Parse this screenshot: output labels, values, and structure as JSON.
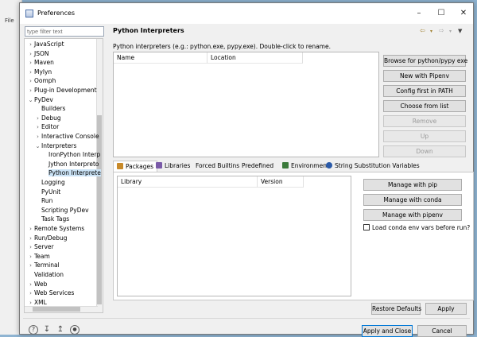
{
  "window": {
    "title": "Preferences"
  },
  "background": {
    "menu_file": "File"
  },
  "filter": {
    "placeholder": "type filter text"
  },
  "tree": [
    {
      "label": "JavaScript",
      "depth": 0,
      "arrow": "›"
    },
    {
      "label": "JSON",
      "depth": 0,
      "arrow": "›"
    },
    {
      "label": "Maven",
      "depth": 0,
      "arrow": "›"
    },
    {
      "label": "Mylyn",
      "depth": 0,
      "arrow": "›"
    },
    {
      "label": "Oomph",
      "depth": 0,
      "arrow": "›"
    },
    {
      "label": "Plug-in Development",
      "depth": 0,
      "arrow": "›"
    },
    {
      "label": "PyDev",
      "depth": 0,
      "arrow": "⌄"
    },
    {
      "label": "Builders",
      "depth": 1,
      "arrow": ""
    },
    {
      "label": "Debug",
      "depth": 1,
      "arrow": "›"
    },
    {
      "label": "Editor",
      "depth": 1,
      "arrow": "›"
    },
    {
      "label": "Interactive Console",
      "depth": 1,
      "arrow": "›"
    },
    {
      "label": "Interpreters",
      "depth": 1,
      "arrow": "⌄"
    },
    {
      "label": "IronPython Interp",
      "depth": 2,
      "arrow": ""
    },
    {
      "label": "Jython Interpreto",
      "depth": 2,
      "arrow": ""
    },
    {
      "label": "Python Interprete",
      "depth": 2,
      "arrow": "",
      "selected": true
    },
    {
      "label": "Logging",
      "depth": 1,
      "arrow": ""
    },
    {
      "label": "PyUnit",
      "depth": 1,
      "arrow": ""
    },
    {
      "label": "Run",
      "depth": 1,
      "arrow": ""
    },
    {
      "label": "Scripting PyDev",
      "depth": 1,
      "arrow": ""
    },
    {
      "label": "Task Tags",
      "depth": 1,
      "arrow": ""
    },
    {
      "label": "Remote Systems",
      "depth": 0,
      "arrow": "›"
    },
    {
      "label": "Run/Debug",
      "depth": 0,
      "arrow": "›"
    },
    {
      "label": "Server",
      "depth": 0,
      "arrow": "›"
    },
    {
      "label": "Team",
      "depth": 0,
      "arrow": "›"
    },
    {
      "label": "Terminal",
      "depth": 0,
      "arrow": "›"
    },
    {
      "label": "Validation",
      "depth": 0,
      "arrow": ""
    },
    {
      "label": "Web",
      "depth": 0,
      "arrow": "›"
    },
    {
      "label": "Web Services",
      "depth": 0,
      "arrow": "›"
    },
    {
      "label": "XML",
      "depth": 0,
      "arrow": "›"
    }
  ],
  "page": {
    "title": "Python Interpreters",
    "description": "Python interpreters (e.g.: python.exe, pypy.exe).   Double-click to rename."
  },
  "interpreters_table": {
    "col_name": "Name",
    "col_location": "Location"
  },
  "interp_buttons": [
    {
      "label": "Browse for python/pypy exe",
      "enabled": true
    },
    {
      "label": "New with Pipenv",
      "enabled": true
    },
    {
      "label": "Config first in PATH",
      "enabled": true
    },
    {
      "label": "Choose from list",
      "enabled": true
    },
    {
      "label": "Remove",
      "enabled": false
    },
    {
      "label": "Up",
      "enabled": false
    },
    {
      "label": "Down",
      "enabled": false
    }
  ],
  "tabs": [
    "Packages",
    "Libraries",
    "Forced Builtins",
    "Predefined",
    "Environment",
    "String Substitution Variables"
  ],
  "packages_table": {
    "col_library": "Library",
    "col_version": "Version"
  },
  "pkg_buttons": [
    "Manage with pip",
    "Manage with conda",
    "Manage with pipenv"
  ],
  "conda_checkbox": {
    "label": "Load conda env vars before run?",
    "checked": false
  },
  "footer": {
    "restore_defaults": "Restore Defaults",
    "apply": "Apply",
    "apply_and_close": "Apply and Close",
    "cancel": "Cancel"
  },
  "colors": {
    "accent": "#0078d7",
    "selection": "#cce4f7"
  }
}
